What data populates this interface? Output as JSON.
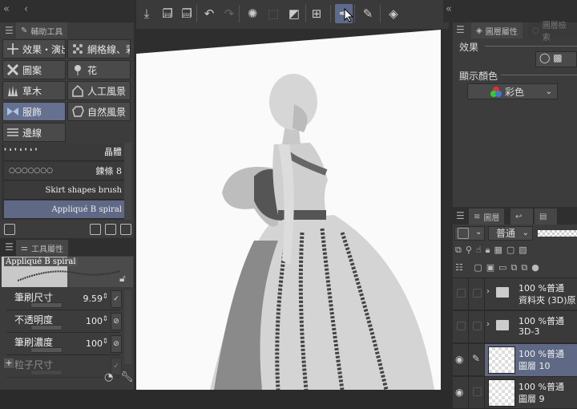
{
  "left_panel": {
    "aux_tab": "輔助工具",
    "categories": [
      {
        "label": "效果・演出",
        "icon": "sparkle-icon"
      },
      {
        "label": "網格線、彩",
        "icon": "grid-dots-icon"
      },
      {
        "label": "圖案",
        "icon": "pattern-icon"
      },
      {
        "label": "花",
        "icon": "flower-icon"
      },
      {
        "label": "草木",
        "icon": "grass-icon"
      },
      {
        "label": "人工風景",
        "icon": "house-icon"
      },
      {
        "label": "服飾",
        "icon": "bow-icon"
      },
      {
        "label": "自然風景",
        "icon": "rock-icon"
      },
      {
        "label": "邊線",
        "icon": "lines-icon"
      }
    ],
    "brushes": [
      "晶體",
      "鍊條 8",
      "Skirt shapes brush",
      "Appliqué B spiral"
    ],
    "tool_property_tab": "工具屬性",
    "tool_name": "Appliqué B spiral",
    "properties": [
      {
        "label": "筆刷尺寸",
        "value": "9.59"
      },
      {
        "label": "不透明度",
        "value": "100"
      },
      {
        "label": "筆刷濃度",
        "value": "100"
      },
      {
        "label": "粒子尺寸",
        "value": ""
      }
    ]
  },
  "toolbar": {
    "buttons": [
      "save-icon",
      "export-jpg-icon",
      "export-psd-icon",
      "undo-icon",
      "redo-icon",
      "loading-icon",
      "transform-icon",
      "fill-icon",
      "perspective-grid-icon",
      "pen-icon",
      "pencil-icon",
      "eraser-icon"
    ],
    "jpg": "jpg",
    "psd": "psd"
  },
  "layer_property": {
    "tab": "圖層屬性",
    "tab2": "圖層檢索",
    "effect_label": "效果",
    "display_color_label": "顯示顏色",
    "display_color_value": "彩色"
  },
  "layers": {
    "tab": "圖層",
    "blend_mode": "普通",
    "items": [
      {
        "line1": "100 %普通",
        "line2": "資料夾 (3D)原",
        "type": "folder",
        "visible": false,
        "selected": false
      },
      {
        "line1": "100 %普通",
        "line2": "3D-3",
        "type": "folder",
        "visible": false,
        "selected": false
      },
      {
        "line1": "100 %普通",
        "line2": "圖層 10",
        "type": "layer",
        "visible": true,
        "selected": true
      },
      {
        "line1": "100 %普通",
        "line2": "圖層 9",
        "type": "layer",
        "visible": true,
        "selected": false
      }
    ]
  },
  "colors": {
    "accent": "#5f6985",
    "panel": "#3c3c3c"
  }
}
